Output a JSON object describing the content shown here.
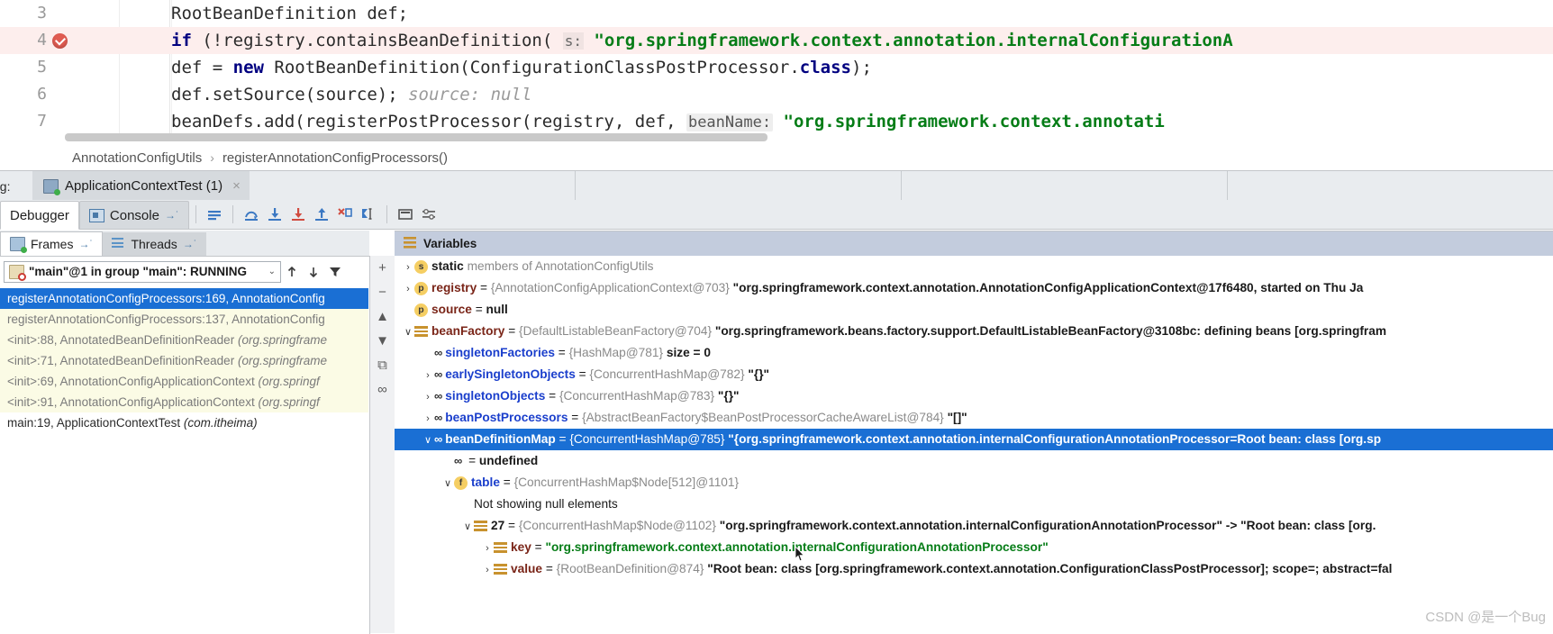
{
  "editor": {
    "lines": [
      {
        "num": "3",
        "highlight": false,
        "breakpoint": false,
        "parts": [
          {
            "t": "plain",
            "s": "RootBeanDefinition def;"
          }
        ]
      },
      {
        "num": "4",
        "highlight": true,
        "breakpoint": true,
        "parts": [
          {
            "t": "kw",
            "s": "if"
          },
          {
            "t": "plain",
            "s": " (!registry.containsBeanDefinition( "
          },
          {
            "t": "phint-s",
            "s": "s:"
          },
          {
            "t": "plain",
            "s": " "
          },
          {
            "t": "str",
            "s": "\"org.springframework.context.annotation.internalConfigurationA"
          }
        ]
      },
      {
        "num": "5",
        "highlight": false,
        "breakpoint": false,
        "parts": [
          {
            "t": "plain",
            "s": "    def = "
          },
          {
            "t": "kw",
            "s": "new"
          },
          {
            "t": "plain",
            "s": " RootBeanDefinition(ConfigurationClassPostProcessor."
          },
          {
            "t": "kw",
            "s": "class"
          },
          {
            "t": "plain",
            "s": ");"
          }
        ]
      },
      {
        "num": "6",
        "highlight": false,
        "breakpoint": false,
        "parts": [
          {
            "t": "plain",
            "s": "    def.setSource(source);  "
          },
          {
            "t": "hint",
            "s": "source: null"
          }
        ]
      },
      {
        "num": "7",
        "highlight": false,
        "breakpoint": false,
        "parts": [
          {
            "t": "plain",
            "s": "    beanDefs.add(registerPostProcessor(registry, def,  "
          },
          {
            "t": "phint",
            "s": "beanName:"
          },
          {
            "t": "plain",
            "s": " "
          },
          {
            "t": "str",
            "s": "\"org.springframework.context.annotati"
          }
        ]
      }
    ]
  },
  "breadcrumb": {
    "items": [
      "AnnotationConfigUtils",
      "registerAnnotationConfigProcessors()"
    ],
    "separator": "›"
  },
  "debug_window": {
    "label": "ug:",
    "tab_title": "ApplicationContextTest (1)",
    "tab_close": "×"
  },
  "debugger_tabs": {
    "tabs": [
      {
        "label": "Debugger",
        "active": true,
        "icon": null
      },
      {
        "label": "Console",
        "active": false,
        "icon": "console-icon",
        "suffix": "→˙"
      }
    ],
    "toolbar": [
      {
        "name": "show-execution-point-icon"
      },
      {
        "name": "step-over-icon"
      },
      {
        "name": "step-into-icon"
      },
      {
        "name": "force-step-into-icon"
      },
      {
        "name": "step-out-icon"
      },
      {
        "name": "drop-frame-icon"
      },
      {
        "name": "run-to-cursor-icon"
      },
      {
        "name": "evaluate-expression-icon"
      },
      {
        "name": "settings-icon"
      }
    ]
  },
  "frames_panel": {
    "tabs": [
      {
        "label": "Frames",
        "suffix": "→˙",
        "active": true,
        "icon": "frames-icon"
      },
      {
        "label": "Threads",
        "suffix": "→˙",
        "active": false,
        "icon": "threads-icon"
      }
    ],
    "thread_selector": {
      "value": "\"main\"@1 in group \"main\": RUNNING",
      "arrow": "⌄"
    },
    "toolbar": [
      {
        "name": "move-up-icon",
        "glyph": "↑"
      },
      {
        "name": "move-down-icon",
        "glyph": "↓"
      },
      {
        "name": "filter-icon",
        "glyph": "▼"
      }
    ],
    "frames": [
      {
        "text": "registerAnnotationConfigProcessors:169, AnnotationConfig",
        "package": "",
        "selected": true,
        "library": false
      },
      {
        "text": "registerAnnotationConfigProcessors:137, AnnotationConfig",
        "package": "",
        "selected": false,
        "library": true
      },
      {
        "text": "<init>:88, AnnotatedBeanDefinitionReader ",
        "package": "(org.springframe",
        "selected": false,
        "library": true
      },
      {
        "text": "<init>:71, AnnotatedBeanDefinitionReader ",
        "package": "(org.springframe",
        "selected": false,
        "library": true
      },
      {
        "text": "<init>:69, AnnotationConfigApplicationContext ",
        "package": "(org.springf",
        "selected": false,
        "library": true
      },
      {
        "text": "<init>:91, AnnotationConfigApplicationContext ",
        "package": "(org.springf",
        "selected": false,
        "library": true
      },
      {
        "text": "main:19, ApplicationContextTest ",
        "package": "(com.itheima)",
        "selected": false,
        "library": false
      }
    ]
  },
  "variables_panel": {
    "title": "Variables",
    "gutter_buttons": [
      {
        "name": "add-watch-button",
        "glyph": "+"
      },
      {
        "name": "remove-watch-button",
        "glyph": "−"
      },
      {
        "name": "move-watch-up-button",
        "glyph": "▲"
      },
      {
        "name": "move-watch-down-button",
        "glyph": "▼"
      },
      {
        "name": "copy-value-button",
        "glyph": "⧉"
      },
      {
        "name": "show-references-button",
        "glyph": "∞"
      }
    ],
    "rows": [
      {
        "indent": 0,
        "chevron": "›",
        "icon": "static",
        "badge": "s",
        "selected": false,
        "segments": [
          {
            "t": "vstatic",
            "s": "static"
          },
          {
            "t": "vgray",
            "s": " members of AnnotationConfigUtils"
          }
        ]
      },
      {
        "indent": 0,
        "chevron": "›",
        "icon": "param",
        "badge": "p",
        "selected": false,
        "segments": [
          {
            "t": "vname",
            "s": "registry"
          },
          {
            "t": "veq",
            "s": " = "
          },
          {
            "t": "vgray",
            "s": "{AnnotationConfigApplicationContext@703} "
          },
          {
            "t": "vval",
            "s": "\"org.springframework.context.annotation.AnnotationConfigApplicationContext@17f6480, started on Thu Ja"
          }
        ]
      },
      {
        "indent": 0,
        "chevron": "",
        "icon": "param",
        "badge": "p",
        "selected": false,
        "segments": [
          {
            "t": "vname",
            "s": "source"
          },
          {
            "t": "veq",
            "s": " = "
          },
          {
            "t": "vval",
            "s": "null"
          }
        ]
      },
      {
        "indent": 0,
        "chevron": "∨",
        "icon": "field-lines",
        "badge": "",
        "selected": false,
        "segments": [
          {
            "t": "vname",
            "s": "beanFactory"
          },
          {
            "t": "veq",
            "s": " = "
          },
          {
            "t": "vgray",
            "s": "{DefaultListableBeanFactory@704} "
          },
          {
            "t": "vval",
            "s": "\"org.springframework.beans.factory.support.DefaultListableBeanFactory@3108bc: defining beans [org.springfram"
          }
        ]
      },
      {
        "indent": 1,
        "chevron": "",
        "icon": "oo",
        "badge": "",
        "selected": false,
        "segments": [
          {
            "t": "vname blue",
            "s": "singletonFactories"
          },
          {
            "t": "veq",
            "s": " = "
          },
          {
            "t": "vgray",
            "s": "{HashMap@781} "
          },
          {
            "t": "vval",
            "s": " size = 0"
          }
        ]
      },
      {
        "indent": 1,
        "chevron": "›",
        "icon": "oo",
        "badge": "",
        "selected": false,
        "segments": [
          {
            "t": "vname blue",
            "s": "earlySingletonObjects"
          },
          {
            "t": "veq",
            "s": " = "
          },
          {
            "t": "vgray",
            "s": "{ConcurrentHashMap@782} "
          },
          {
            "t": "vval",
            "s": "\"{}\""
          }
        ]
      },
      {
        "indent": 1,
        "chevron": "›",
        "icon": "oo",
        "badge": "",
        "selected": false,
        "segments": [
          {
            "t": "vname blue",
            "s": "singletonObjects"
          },
          {
            "t": "veq",
            "s": " = "
          },
          {
            "t": "vgray",
            "s": "{ConcurrentHashMap@783} "
          },
          {
            "t": "vval",
            "s": "\"{}\""
          }
        ]
      },
      {
        "indent": 1,
        "chevron": "›",
        "icon": "oo",
        "badge": "",
        "selected": false,
        "segments": [
          {
            "t": "vname blue",
            "s": "beanPostProcessors"
          },
          {
            "t": "veq",
            "s": " = "
          },
          {
            "t": "vgray",
            "s": "{AbstractBeanFactory$BeanPostProcessorCacheAwareList@784} "
          },
          {
            "t": "vval",
            "s": "\"[]\""
          }
        ]
      },
      {
        "indent": 1,
        "chevron": "∨",
        "icon": "oo",
        "badge": "",
        "selected": true,
        "segments": [
          {
            "t": "vname blue",
            "s": "beanDefinitionMap"
          },
          {
            "t": "veq",
            "s": " = "
          },
          {
            "t": "vgray",
            "s": "{ConcurrentHashMap@785} "
          },
          {
            "t": "vval",
            "s": "\"{org.springframework.context.annotation.internalConfigurationAnnotationProcessor=Root bean: class [org.sp"
          }
        ]
      },
      {
        "indent": 2,
        "chevron": "",
        "icon": "oo",
        "badge": "",
        "selected": false,
        "segments": [
          {
            "t": "veq",
            "s": " = "
          },
          {
            "t": "vval",
            "s": "undefined"
          }
        ]
      },
      {
        "indent": 2,
        "chevron": "∨",
        "icon": "field",
        "badge": "f",
        "selected": false,
        "segments": [
          {
            "t": "vname blue",
            "s": "table"
          },
          {
            "t": "veq",
            "s": " = "
          },
          {
            "t": "vgray",
            "s": "{ConcurrentHashMap$Node[512]@1101}"
          }
        ]
      },
      {
        "indent": 3,
        "chevron": "",
        "icon": "none",
        "badge": "",
        "selected": false,
        "segments": [
          {
            "t": "vplain",
            "s": "Not showing null elements"
          }
        ]
      },
      {
        "indent": 3,
        "chevron": "∨",
        "icon": "field-lines",
        "badge": "",
        "selected": false,
        "segments": [
          {
            "t": "vname dark",
            "s": "27"
          },
          {
            "t": "veq",
            "s": " = "
          },
          {
            "t": "vgray",
            "s": "{ConcurrentHashMap$Node@1102} "
          },
          {
            "t": "vval",
            "s": "\"org.springframework.context.annotation.internalConfigurationAnnotationProcessor\" -> \"Root bean: class [org."
          }
        ]
      },
      {
        "indent": 4,
        "chevron": "›",
        "icon": "field-lines",
        "badge": "",
        "selected": false,
        "segments": [
          {
            "t": "vname",
            "s": "key"
          },
          {
            "t": "veq",
            "s": " = "
          },
          {
            "t": "vstr",
            "s": "\"org.springframework.context.annotation.internalConfigurationAnnotationProcessor\""
          }
        ]
      },
      {
        "indent": 4,
        "chevron": "›",
        "icon": "field-lines",
        "badge": "",
        "selected": false,
        "segments": [
          {
            "t": "vname",
            "s": "value"
          },
          {
            "t": "veq",
            "s": " = "
          },
          {
            "t": "vgray",
            "s": "{RootBeanDefinition@874} "
          },
          {
            "t": "vval",
            "s": "\"Root bean: class [org.springframework.context.annotation.ConfigurationClassPostProcessor]; scope=; abstract=fal"
          }
        ]
      }
    ]
  },
  "watermark": "CSDN @是一个Bug"
}
